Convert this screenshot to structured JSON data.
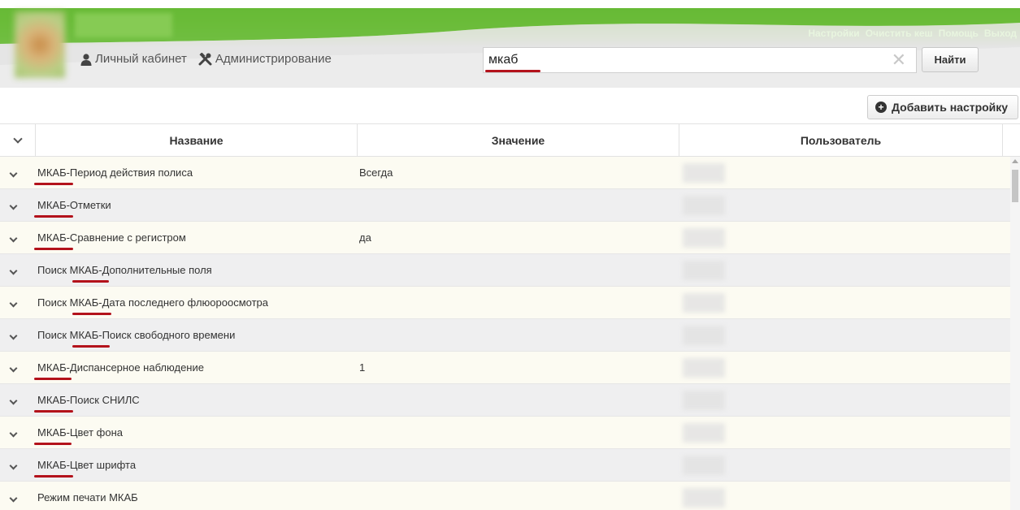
{
  "header": {
    "top_links": [
      "Настройки",
      "Очистить кеш",
      "Помощь",
      "Выход"
    ],
    "nav": [
      {
        "icon": "user-icon",
        "label": "Личный кабинет"
      },
      {
        "icon": "tools-icon",
        "label": "Администрирование"
      }
    ],
    "search": {
      "value": "мкаб",
      "placeholder": ""
    },
    "search_button": "Найти"
  },
  "toolbar": {
    "add_label": "Добавить настройку"
  },
  "table": {
    "columns": [
      "Название",
      "Значение",
      "Пользователь"
    ],
    "rows": [
      {
        "name": "МКАБ-Период действия полиса",
        "value": "Всегда"
      },
      {
        "name": "МКАБ-Отметки",
        "value": ""
      },
      {
        "name": "МКАБ-Сравнение с регистром",
        "value": "да"
      },
      {
        "name": "Поиск МКАБ-Дополнительные поля",
        "value": ""
      },
      {
        "name": "Поиск МКАБ-Дата последнего флюороосмотра",
        "value": ""
      },
      {
        "name": "Поиск МКАБ-Поиск свободного времени",
        "value": ""
      },
      {
        "name": "МКАБ-Диспансерное наблюдение",
        "value": "1"
      },
      {
        "name": "МКАБ-Поиск СНИЛС",
        "value": ""
      },
      {
        "name": "МКАБ-Цвет фона",
        "value": ""
      },
      {
        "name": "МКАБ-Цвет шрифта",
        "value": ""
      },
      {
        "name": "Режим печати МКАБ",
        "value": ""
      }
    ]
  },
  "colors": {
    "accent_green": "#6cbf3a",
    "highlight_red": "#b3121b",
    "row_odd": "#fcfbf2",
    "row_even": "#efeff0"
  }
}
